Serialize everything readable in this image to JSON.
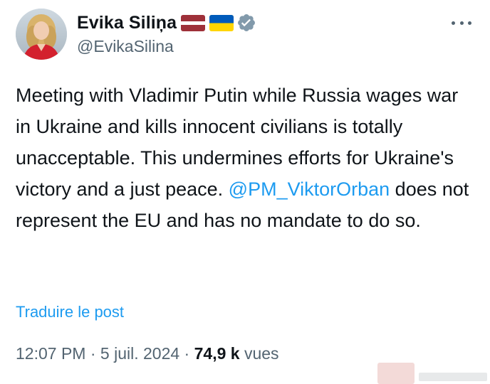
{
  "author": {
    "display_name": "Evika Siliņa",
    "handle": "@EvikaSilina",
    "flags": [
      "latvia-flag",
      "ukraine-flag"
    ],
    "verified_icon": "verified-badge-icon",
    "verified_color": "#829aab"
  },
  "more_icon": "more-horizontal-icon",
  "tweet": {
    "text_before": "Meeting with Vladimir Putin while Russia wages war in Ukraine and kills innocent civilians is totally unacceptable. This undermines efforts for Ukraine's victory and a just peace. ",
    "mention": "@PM_ViktorOrban",
    "text_after": " does not represent the EU and has no mandate to do so."
  },
  "translate_label": "Traduire le post",
  "meta": {
    "time": "12:07 PM",
    "separator1": " · ",
    "date": "5 juil. 2024",
    "separator2": " · ",
    "views_count": "74,9 k",
    "views_label": " vues"
  },
  "watermark": {
    "logo_icon": "b2-brussels-logo-icon"
  },
  "colors": {
    "text": "#0f1419",
    "secondary": "#536471",
    "link": "#1d9bf0"
  }
}
